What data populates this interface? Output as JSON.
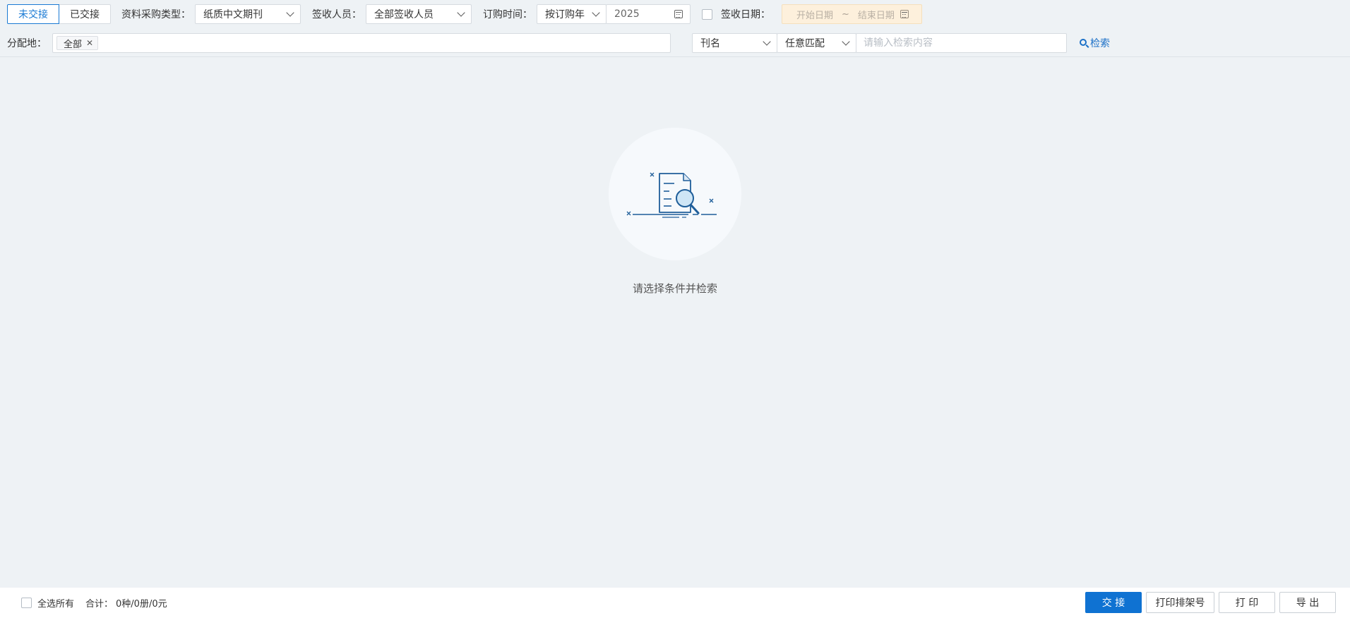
{
  "tabs": [
    {
      "label": "未交接",
      "active": true
    },
    {
      "label": "已交接",
      "active": false
    }
  ],
  "filters": {
    "material_type_label": "资料采购类型：",
    "material_type_value": "纸质中文期刊",
    "receiver_label": "签收人员：",
    "receiver_value": "全部签收人员",
    "order_time_label": "订购时间：",
    "order_time_mode": "按订购年",
    "order_year": "2025",
    "sign_date_label": "签收日期：",
    "date_start_placeholder": "开始日期",
    "date_sep": "~",
    "date_end_placeholder": "结束日期",
    "location_label": "分配地：",
    "location_tag": "全部",
    "field_select": "刊名",
    "match_select": "任意匹配",
    "search_placeholder": "请输入检索内容",
    "search_button": "检索"
  },
  "empty": {
    "message": "请选择条件并检索"
  },
  "footer": {
    "select_all": "全选所有",
    "total_label": "合计：",
    "total_value": "0种/0册/0元",
    "buttons": {
      "handover": "交 接",
      "print_shelf": "打印排架号",
      "print": "打 印",
      "export": "导 出"
    }
  },
  "colors": {
    "accent": "#1a7ad4",
    "primary_button": "#0f72d2",
    "background": "#eef2f5",
    "date_range_bg": "#fdf0dc"
  }
}
